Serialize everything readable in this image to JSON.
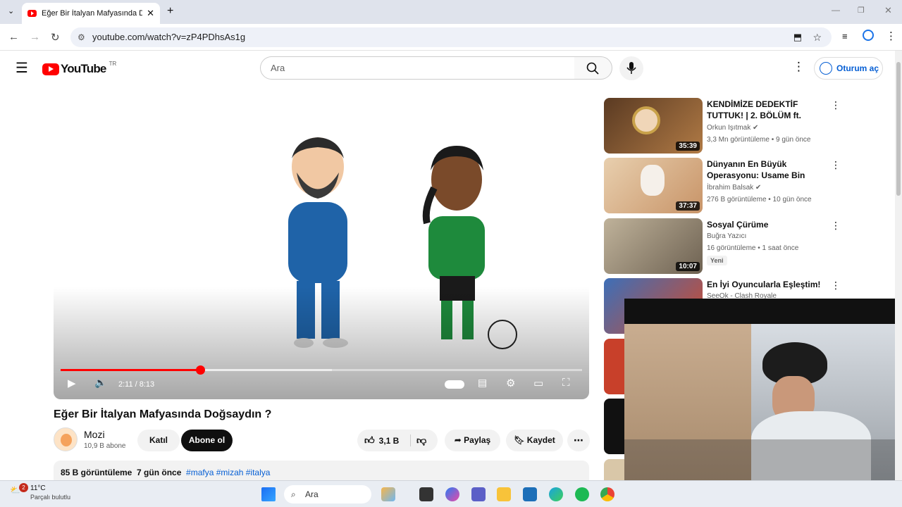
{
  "browser": {
    "tab_title": "Eğer Bir İtalyan Mafyasında Doğ",
    "url": "youtube.com/watch?v=zP4PDhsAs1g"
  },
  "header": {
    "logo_text": "YouTube",
    "region": "TR",
    "search_placeholder": "Ara",
    "signin_label": "Oturum aç"
  },
  "player": {
    "time": "2:11 / 8:13",
    "progress_fraction": 0.268,
    "loaded_fraction": 0.52
  },
  "video": {
    "title": "Eğer Bir İtalyan Mafyasında Doğsaydın ?",
    "channel": "Mozi",
    "subscribers": "10,9 B abone",
    "join_label": "Katıl",
    "subscribe_label": "Abone ol",
    "likes": "3,1 B",
    "share_label": "Paylaş",
    "save_label": "Kaydet",
    "views": "85 B görüntüleme",
    "date": "7 gün önce",
    "tags": "#mafya #mizah #italya"
  },
  "recommendations": [
    {
      "title": "KENDİMİZE DEDEKTİF TUTTUK! | 2. BÖLÜM  ft. @uberkuloz",
      "channel": "Orkun Işıtmak",
      "meta": "3,3 Mn görüntüleme • 9 gün önce",
      "duration": "35:39"
    },
    {
      "title": "Dünyanın En Büyük Operasyonu: Usame Bin Ladin Gerçekten ...",
      "channel": "İbrahim Balsak",
      "meta": "276 B görüntüleme • 10 gün önce",
      "duration": "37:37"
    },
    {
      "title": "Sosyal Çürüme",
      "channel": "Buğra Yazıcı",
      "meta": "16 görüntüleme • 1 saat önce",
      "duration": "10:07",
      "badge": "Yeni"
    },
    {
      "title": "En İyi Oyuncularla Eşleştim!",
      "channel": "SeeOk - Clash Royale"
    }
  ],
  "taskbar": {
    "weather": "11°C",
    "notif_count": "2",
    "search_label": "Ara",
    "weather_sub": "Parçalı bulutlu"
  }
}
